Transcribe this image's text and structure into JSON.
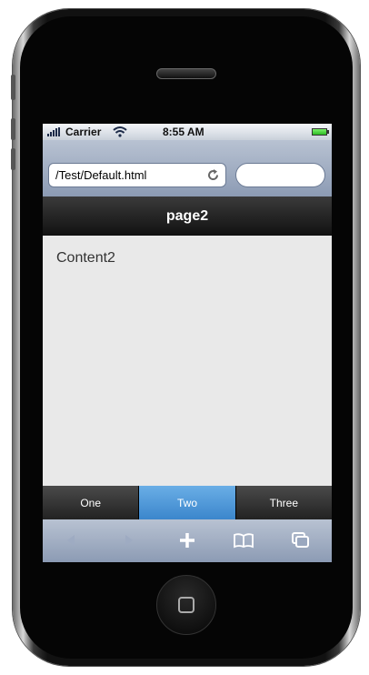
{
  "status_bar": {
    "carrier": "Carrier",
    "time": "8:55 AM"
  },
  "browser": {
    "address": "/Test/Default.html",
    "search_placeholder": ""
  },
  "page": {
    "header_title": "page2",
    "content": "Content2"
  },
  "tabs": [
    {
      "label": "One",
      "active": false
    },
    {
      "label": "Two",
      "active": true
    },
    {
      "label": "Three",
      "active": false
    }
  ],
  "toolbar": {
    "icons": [
      "back-icon",
      "forward-icon",
      "add-icon",
      "bookmarks-icon",
      "pages-icon"
    ]
  },
  "colors": {
    "active_tab": "#4a90d9",
    "header_bg": "#1e1e1e"
  }
}
